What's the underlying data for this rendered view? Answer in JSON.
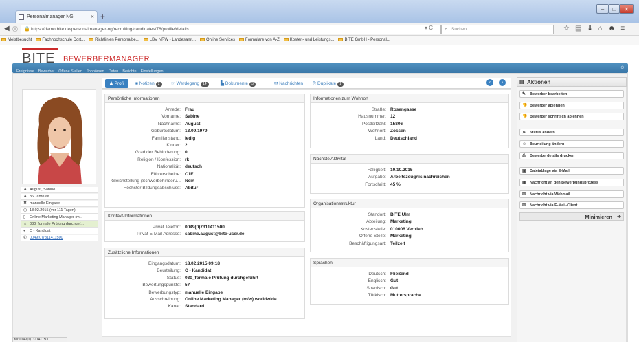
{
  "browser": {
    "tab_title": "Personalmanager NG",
    "url": "https://demo.bite.de/personalmanager-ng/recruiting/candidates/78/profile/details",
    "search_placeholder": "Suchen",
    "bookmarks": [
      "Meistbesucht",
      "Fachhochschule Dort...",
      "Richtlinien Personalbe...",
      "LBV NRW - Landesamt...",
      "Online Services",
      "Formulare von A-Z",
      "Kosten- und Leistungs...",
      "BITE GmbH - Personal..."
    ]
  },
  "app": {
    "logo": "BITE",
    "logo_sub": "BEWERBERMANAGER",
    "menu": [
      "Ereignisse",
      "Bewerber",
      "Offene Stellen",
      "Jobbörsen",
      "Daten",
      "Berichte",
      "Einstellungen"
    ]
  },
  "candidate_sidebar": {
    "items": [
      {
        "icon": "user-icon",
        "text": "August, Sabine"
      },
      {
        "icon": "user-icon",
        "text": "36 Jahre alt"
      },
      {
        "icon": "tools-icon",
        "text": "manuelle Eingabe"
      },
      {
        "icon": "clock-icon",
        "text": "18.02.2015 (vor 111 Tagen)"
      },
      {
        "icon": "document-icon",
        "text": "Online Marketing Manager (m..."
      },
      {
        "icon": "star-icon",
        "text": "030_formale Prüfung durchgef..."
      },
      {
        "icon": "target-icon",
        "text": "C - Kandidat"
      },
      {
        "icon": "phone-icon",
        "text": "0049(0)7311411500"
      }
    ],
    "status_url": "tel:0049(0)7311411500"
  },
  "tabs": [
    {
      "label": "Profil",
      "badge": ""
    },
    {
      "label": "Notizen",
      "badge": "2"
    },
    {
      "label": "Werdegang",
      "badge": "14"
    },
    {
      "label": "Dokumente",
      "badge": "3"
    },
    {
      "label": "Nachrichten",
      "badge": ""
    },
    {
      "label": "Duplikate",
      "badge": "1"
    }
  ],
  "personal": {
    "title": "Persönliche Informationen",
    "rows": [
      [
        "Anrede:",
        "Frau"
      ],
      [
        "Vorname:",
        "Sabine"
      ],
      [
        "Nachname:",
        "August"
      ],
      [
        "Geburtsdatum:",
        "13.09.1979"
      ],
      [
        "Familienstand:",
        "ledig"
      ],
      [
        "Kinder:",
        "2"
      ],
      [
        "Grad der Behinderung:",
        "0"
      ],
      [
        "Religion / Konfession:",
        "rk"
      ],
      [
        "Nationalität:",
        "deutsch"
      ],
      [
        "Führerscheine:",
        "C1E"
      ],
      [
        "Gleichstellung (Schwerbehinderu...",
        "Nein"
      ],
      [
        "Höchster Bildungsabschluss:",
        "Abitur"
      ]
    ]
  },
  "contact": {
    "title": "Kontakt-Informationen",
    "rows": [
      [
        "Privat Telefon:",
        "0049(0)7311411500"
      ],
      [
        "Privat E-Mail Adresse:",
        "sabine.august@bite-user.de"
      ]
    ]
  },
  "extra": {
    "title": "Zusätzliche Informationen",
    "rows": [
      [
        "Eingangsdatum:",
        "18.02.2015 09:18"
      ],
      [
        "Beurteilung:",
        "C - Kandidat"
      ],
      [
        "Status:",
        "030_formale Prüfung durchgeführt"
      ],
      [
        "Bewertungspunkte:",
        "57"
      ],
      [
        "Bewerbungstyp:",
        "manuelle Eingabe"
      ],
      [
        "Ausschreibung:",
        "Online Marketing Manager (m/w) worldwide"
      ],
      [
        "Kanal:",
        "Standard"
      ]
    ]
  },
  "address": {
    "title": "Informationen zum Wohnort",
    "rows": [
      [
        "Straße:",
        "Rosengasse"
      ],
      [
        "Hausnummer:",
        "12"
      ],
      [
        "Postleitzahl:",
        "15806"
      ],
      [
        "Wohnort:",
        "Zossen"
      ],
      [
        "Land:",
        "Deutschland"
      ]
    ]
  },
  "activity": {
    "title": "Nächste Aktivität",
    "rows": [
      [
        "Fälligkeit:",
        "10.10.2015"
      ],
      [
        "Aufgabe:",
        "Arbeitszeugnis nachreichen"
      ],
      [
        "Fortschritt:",
        "45 %"
      ]
    ]
  },
  "org": {
    "title": "Organisationsstruktur",
    "rows": [
      [
        "Standort:",
        "BITE Ulm"
      ],
      [
        "Abteilung:",
        "Marketing"
      ],
      [
        "Kostenstelle:",
        "010006 Vertrieb"
      ],
      [
        "Offene Stelle:",
        "Marketing"
      ],
      [
        "Beschäftigungsart:",
        "Teilzeit"
      ]
    ]
  },
  "languages": {
    "title": "Sprachen",
    "rows": [
      [
        "Deutsch:",
        "Fließend"
      ],
      [
        "Englisch:",
        "Gut"
      ],
      [
        "Spanisch:",
        "Gut"
      ],
      [
        "Türkisch:",
        "Muttersprache"
      ]
    ]
  },
  "actions": {
    "title": "Aktionen",
    "buttons": [
      {
        "icon": "edit-icon",
        "label": "Bewerber bearbeiten"
      },
      {
        "icon": "thumbs-down-icon",
        "label": "Bewerber ablehnen"
      },
      {
        "icon": "thumbs-down-icon",
        "label": "Bewerber schriftlich ablehnen"
      },
      {
        "icon": "tag-icon",
        "label": "Status ändern"
      },
      {
        "icon": "smile-icon",
        "label": "Beurteilung ändern"
      },
      {
        "icon": "print-icon",
        "label": "Bewerberdetails drucken"
      },
      {
        "icon": "folder-icon",
        "label": "Dateiablage via E-Mail"
      },
      {
        "icon": "message-icon",
        "label": "Nachricht an den Bewerbungsprozess"
      },
      {
        "icon": "envelope-icon",
        "label": "Nachricht via Webmail"
      },
      {
        "icon": "envelope-icon",
        "label": "Nachricht via E-Mail-Client"
      }
    ],
    "minimize_label": "Minimieren"
  },
  "colors": {
    "accent": "#3a81c1",
    "brand_red": "#cc2a2a",
    "menubar": "#3f7fb1"
  }
}
